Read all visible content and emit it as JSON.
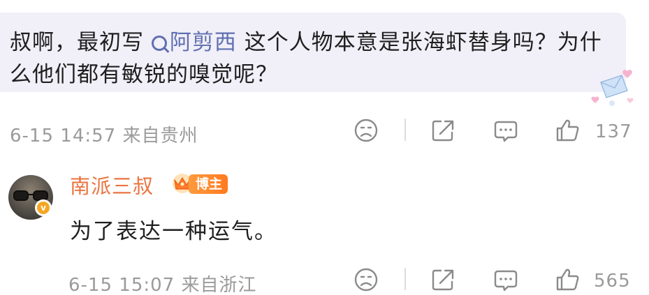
{
  "comment": {
    "text_before": "叔啊，最初写",
    "mention": "阿剪西",
    "text_after": "这个人物本意是张海虾替身吗？为什么他们都有敏锐的嗅觉呢？",
    "time_location": "6-15 14:57 来自贵州",
    "likes": "137"
  },
  "reply": {
    "author": "南派三叔",
    "author_badge": "博主",
    "verified_mark": "v",
    "text": "为了表达一种运气。",
    "time_location": "6-15 15:07 来自浙江",
    "likes": "565"
  },
  "icons": {
    "dislike": "frown-face-icon",
    "share": "share-arrow-icon",
    "comment": "comment-bubble-icon",
    "like": "thumbs-up-icon",
    "search": "search-icon",
    "crown": "crown-icon",
    "decoration": "envelope-hearts-icon"
  },
  "colors": {
    "bubble_bg": "#f1eff8",
    "mention": "#5f6fb0",
    "author_name": "#eb7340",
    "meta_gray": "#9a9a9a",
    "author_tag": "#ff8a2a"
  }
}
